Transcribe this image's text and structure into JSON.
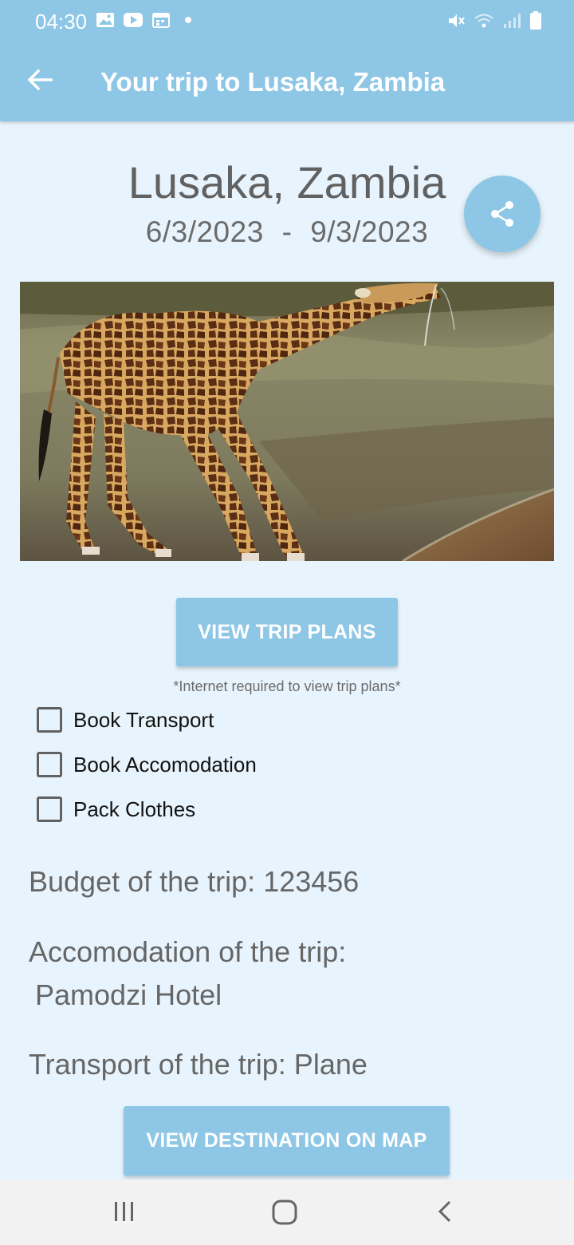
{
  "status": {
    "time": "04:30",
    "left_icons": [
      "image-icon",
      "youtube-icon",
      "calendar-icon",
      "dot-icon"
    ],
    "right_icons": [
      "mute-icon",
      "wifi-icon",
      "signal-icon",
      "battery-icon"
    ]
  },
  "appbar": {
    "title": "Your trip to Lusaka, Zambia",
    "back_icon": "back-arrow-icon"
  },
  "trip": {
    "city": "Lusaka, Zambia",
    "start_date": "6/3/2023",
    "separator": "-",
    "end_date": "9/3/2023",
    "share_icon": "share-icon"
  },
  "actions": {
    "view_plans": "VIEW TRIP PLANS",
    "internet_note": "*Internet required to view trip plans*",
    "view_map": "VIEW DESTINATION ON MAP"
  },
  "checklist": [
    {
      "label": "Book Transport",
      "checked": false
    },
    {
      "label": "Book Accomodation",
      "checked": false
    },
    {
      "label": "Pack Clothes",
      "checked": false
    }
  ],
  "details": {
    "budget": "Budget of the trip: 123456",
    "accommodation_label": "Accomodation of the trip:",
    "accommodation_value": "Pamodzi Hotel",
    "transport": "Transport of the trip: Plane"
  },
  "colors": {
    "primary": "#8ec6e6",
    "background": "#e8f4fd",
    "navbar": "#f2f2f2"
  },
  "navbar": {
    "icons": [
      "recents-icon",
      "home-icon",
      "back-nav-icon"
    ]
  }
}
